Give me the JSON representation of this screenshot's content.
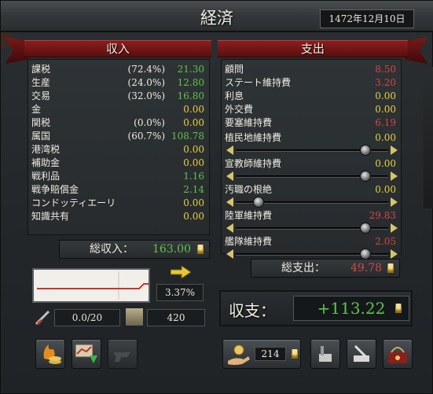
{
  "window": {
    "title": "経済",
    "date": "1472年12月10日"
  },
  "income": {
    "header": "収入",
    "rows": [
      {
        "label": "課税",
        "pct": "(72.4%)",
        "value": "21.30",
        "color": "green"
      },
      {
        "label": "生産",
        "pct": "(24.0%)",
        "value": "12.80",
        "color": "green"
      },
      {
        "label": "交易",
        "pct": "(32.0%)",
        "value": "16.80",
        "color": "green"
      },
      {
        "label": "金",
        "pct": "",
        "value": "0.00",
        "color": "yellow"
      },
      {
        "label": "関税",
        "pct": "(0.0%)",
        "value": "0.00",
        "color": "yellow"
      },
      {
        "label": "属国",
        "pct": "(60.7%)",
        "value": "108.78",
        "color": "green"
      },
      {
        "label": "港湾税",
        "pct": "",
        "value": "0.00",
        "color": "yellow"
      },
      {
        "label": "補助金",
        "pct": "",
        "value": "0.00",
        "color": "yellow"
      },
      {
        "label": "戦利品",
        "pct": "",
        "value": "1.16",
        "color": "green"
      },
      {
        "label": "戦争賠償金",
        "pct": "",
        "value": "2.14",
        "color": "green"
      },
      {
        "label": "コンドッティエーリ",
        "pct": "",
        "value": "0.00",
        "color": "yellow"
      },
      {
        "label": "知識共有",
        "pct": "",
        "value": "0.00",
        "color": "yellow"
      }
    ],
    "total_label": "総収入：",
    "total_value": "163.00"
  },
  "expense": {
    "header": "支出",
    "rows": [
      {
        "label": "顧問",
        "value": "8.50",
        "color": "red"
      },
      {
        "label": "ステート維持費",
        "value": "3.20",
        "color": "red"
      },
      {
        "label": "利息",
        "value": "0.00",
        "color": "yellow"
      },
      {
        "label": "外交費",
        "value": "0.00",
        "color": "yellow"
      },
      {
        "label": "要塞維持費",
        "value": "6.19",
        "color": "red"
      }
    ],
    "slider_rows": [
      {
        "label": "植民地維持費",
        "value": "0.00",
        "color": "yellow",
        "level": 0.88
      },
      {
        "label": "宣教師維持費",
        "value": "0.00",
        "color": "yellow",
        "level": 0.88
      },
      {
        "label": "汚職の根絶",
        "value": "0.00",
        "color": "yellow",
        "level": 0.12
      },
      {
        "label": "陸軍維持費",
        "value": "29.83",
        "color": "red",
        "level": 0.88
      },
      {
        "label": "艦隊維持費",
        "value": "2.05",
        "color": "red",
        "level": 0.88
      }
    ],
    "total_label": "総支出：",
    "total_value": "49.78"
  },
  "balance": {
    "label": "収支：",
    "value": "+113.22"
  },
  "inflation": {
    "value": "3.37%"
  },
  "loans": {
    "value": "0.0/20"
  },
  "treasury": {
    "value": "420"
  },
  "loan_button": {
    "value": "214"
  },
  "colors": {
    "green": "#5fc44a",
    "yellow": "#e8d13a",
    "red": "#d8453f",
    "ribbon": "#7a1818"
  }
}
